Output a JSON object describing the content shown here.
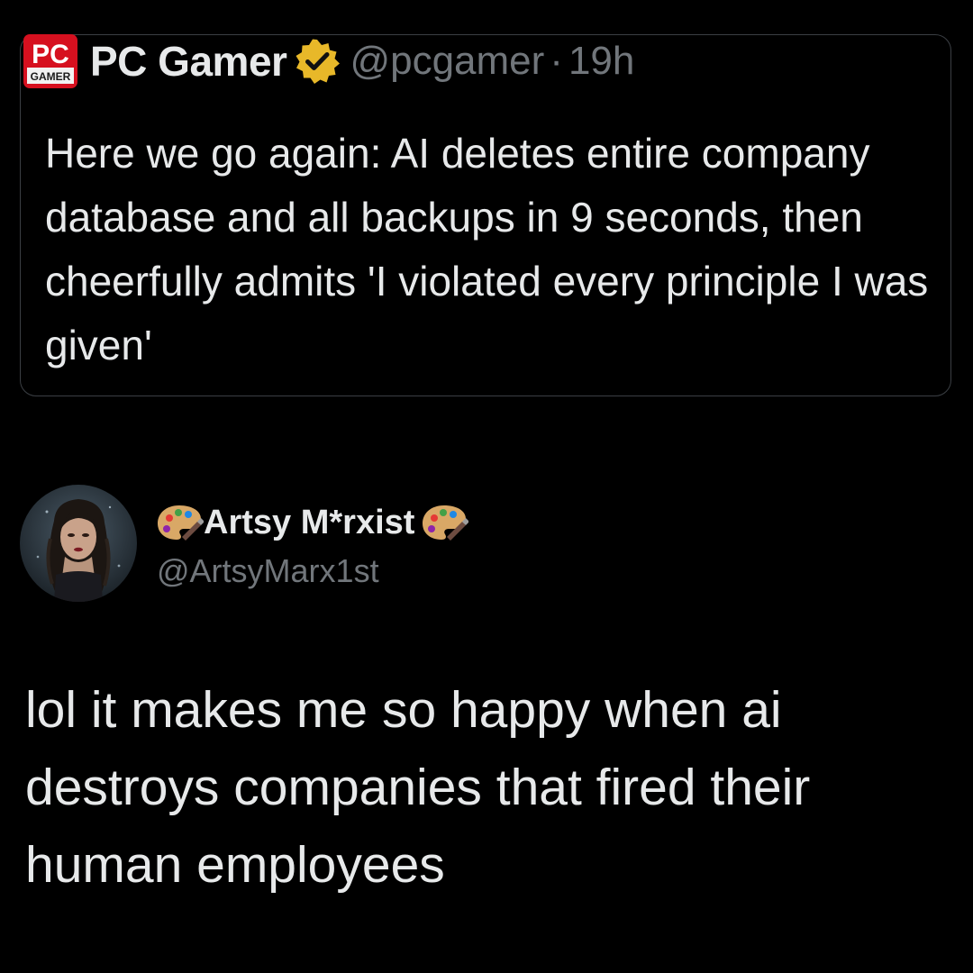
{
  "quoted_tweet": {
    "account_name": "PC Gamer",
    "handle": "@pcgamer",
    "separator": "·",
    "time": "19h",
    "logo_text_top": "PC",
    "logo_text_bottom": "GAMER",
    "logo_icon": "pc-gamer-logo",
    "verified_icon": "verified-badge",
    "text": "Here we go again: AI deletes entire company database and all backups in 9 seconds, then cheerfully admits 'I violated every principle I was given'"
  },
  "author": {
    "display_name": "Artsy M*rxist",
    "handle": "@ArtsyMarx1st",
    "name_icon": "artist-palette",
    "avatar_icon": "profile-photo"
  },
  "post": {
    "text": "lol it makes me so happy when ai destroys companies that fired their human employees"
  },
  "colors": {
    "background": "#000000",
    "primary_text": "#e7e9ea",
    "secondary_text": "#71767b",
    "card_border": "#3b3f44",
    "verified_gold": "#e8b829",
    "logo_red": "#d6101f"
  }
}
